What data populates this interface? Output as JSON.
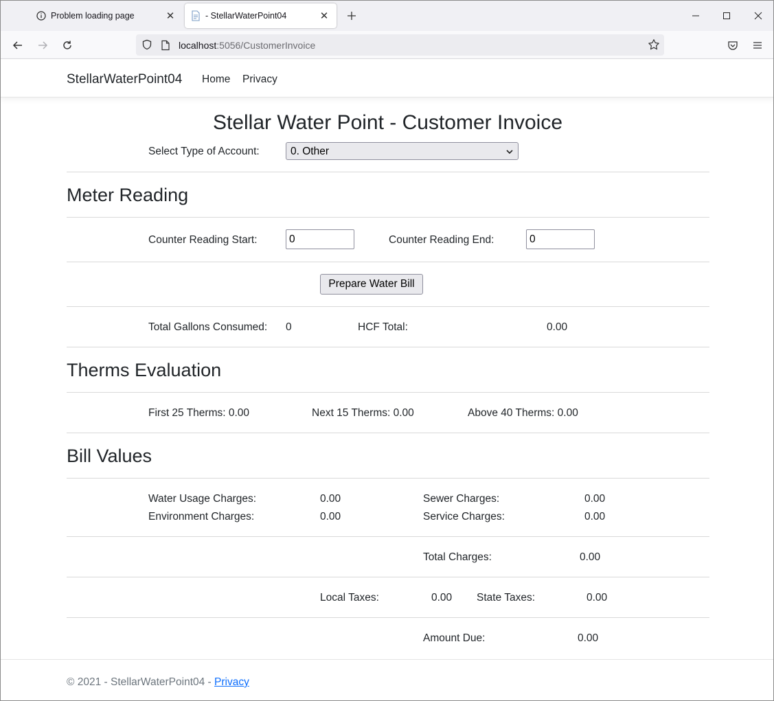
{
  "browser": {
    "tabs": [
      {
        "label": "Problem loading page",
        "active": false,
        "icon": "info-icon"
      },
      {
        "label": "- StellarWaterPoint04",
        "active": true,
        "icon": "page-icon"
      }
    ],
    "url_host": "localhost",
    "url_rest": ":5056/CustomerInvoice"
  },
  "site": {
    "brand": "StellarWaterPoint04",
    "nav": [
      "Home",
      "Privacy"
    ]
  },
  "form": {
    "title": "Stellar Water Point - Customer Invoice",
    "account_type_label": "Select Type of Account:",
    "account_type_value": "0. Other",
    "meter_heading": "Meter Reading",
    "counter_start_label": "Counter Reading Start:",
    "counter_start_value": "0",
    "counter_end_label": "Counter Reading End:",
    "counter_end_value": "0",
    "prepare_button": "Prepare Water Bill",
    "gallons_label": "Total Gallons Consumed:",
    "gallons_value": "0",
    "hcf_label": "HCF Total:",
    "hcf_value": "0.00",
    "therms_heading": "Therms Evaluation",
    "first25": "First 25 Therms: 0.00",
    "next15": "Next 15 Therms: 0.00",
    "above40": "Above 40 Therms: 0.00",
    "bill_heading": "Bill Values",
    "water_usage_label": "Water Usage Charges:",
    "water_usage_value": "0.00",
    "sewer_label": "Sewer Charges:",
    "sewer_value": "0.00",
    "environment_label": "Environment Charges:",
    "environment_value": "0.00",
    "service_label": "Service Charges:",
    "service_value": "0.00",
    "total_charges_label": "Total Charges:",
    "total_charges_value": "0.00",
    "local_taxes_label": "Local Taxes:",
    "local_taxes_value": "0.00",
    "state_taxes_label": "State Taxes:",
    "state_taxes_value": "0.00",
    "amount_due_label": "Amount Due:",
    "amount_due_value": "0.00"
  },
  "footer": {
    "text": "© 2021 - StellarWaterPoint04 - ",
    "link": "Privacy"
  }
}
